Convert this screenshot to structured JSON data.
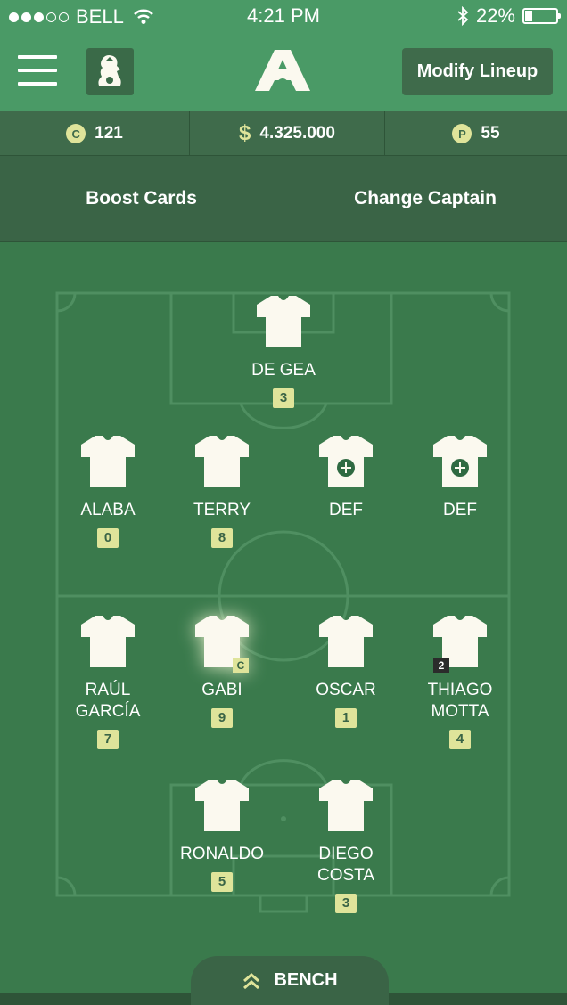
{
  "status_bar": {
    "carrier": "BELL",
    "time": "4:21 PM",
    "battery_percent": "22%",
    "battery_level": 0.22,
    "signal_strength": 3
  },
  "nav": {
    "modify_lineup": "Modify Lineup"
  },
  "stats": {
    "coins_icon": "C",
    "coins": "121",
    "money_icon": "$",
    "money": "4.325.000",
    "points_icon": "P",
    "points": "55"
  },
  "actions": {
    "boost_cards": "Boost Cards",
    "change_captain": "Change Captain"
  },
  "lineup": {
    "goalkeeper": {
      "name": "DE GEA",
      "score": "3"
    },
    "defenders": [
      {
        "name": "ALABA",
        "score": "0"
      },
      {
        "name": "TERRY",
        "score": "8"
      },
      {
        "name": "DEF",
        "empty": true
      },
      {
        "name": "DEF",
        "empty": true
      }
    ],
    "midfielders": [
      {
        "name": "RAÚL GARCÍA",
        "score": "7"
      },
      {
        "name": "GABI",
        "score": "9",
        "captain": "C"
      },
      {
        "name": "OSCAR",
        "score": "1"
      },
      {
        "name": "THIAGO MOTTA",
        "score": "4",
        "badge": "2"
      }
    ],
    "forwards": [
      {
        "name": "RONALDO",
        "score": "5"
      },
      {
        "name": "DIEGO COSTA",
        "score": "3"
      }
    ]
  },
  "bench": {
    "label": "BENCH"
  },
  "colors": {
    "header_green": "#4a9a66",
    "bar_green": "#3f6b4b",
    "pitch_green": "#3a7a4c",
    "accent_yellow": "#dfe49a",
    "jersey": "#fbf9ef"
  }
}
